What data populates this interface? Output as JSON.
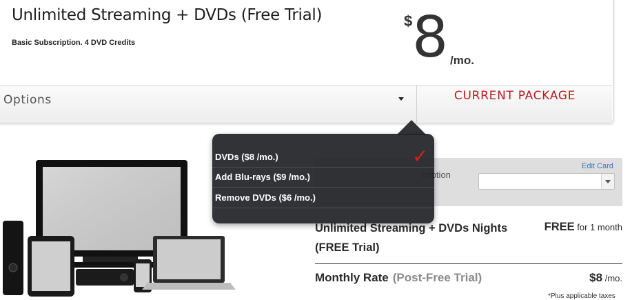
{
  "package": {
    "title": "Unlimited Streaming + DVDs (Free Trial)",
    "subtitle": "Basic Subscription. 4 DVD Credits",
    "price_currency": "$",
    "price_amount": "8",
    "price_unit": "/mo.",
    "options_label": "Options",
    "current_package_label": "CURRENT PACKAGE"
  },
  "options_dropdown": {
    "items": [
      {
        "label": "DVDs ($8 /mo.)",
        "selected": true
      },
      {
        "label": "Add Blu-rays ($9 /mo.)",
        "selected": false
      },
      {
        "label": "Remove DVDs ($6 /mo.)",
        "selected": false
      }
    ],
    "selected_icon": "checkmark-icon"
  },
  "payment": {
    "partial_text": "cription",
    "edit_card_label": "Edit Card",
    "card_select_value": ""
  },
  "summary": {
    "line_name": "Unlimited Streaming + DVDs Nights (FREE Trial)",
    "line_price_main": "FREE",
    "line_price_detail": " for 1 month",
    "monthly_label": "Monthly Rate",
    "monthly_muted": "(Post-Free Trial)",
    "monthly_price_main": "$8",
    "monthly_price_unit": " /mo.",
    "tax_note": "*Plus applicable taxes"
  },
  "colors": {
    "accent_red": "#b81d20",
    "link_blue": "#3a76c4",
    "dropdown_bg": "#222428"
  }
}
